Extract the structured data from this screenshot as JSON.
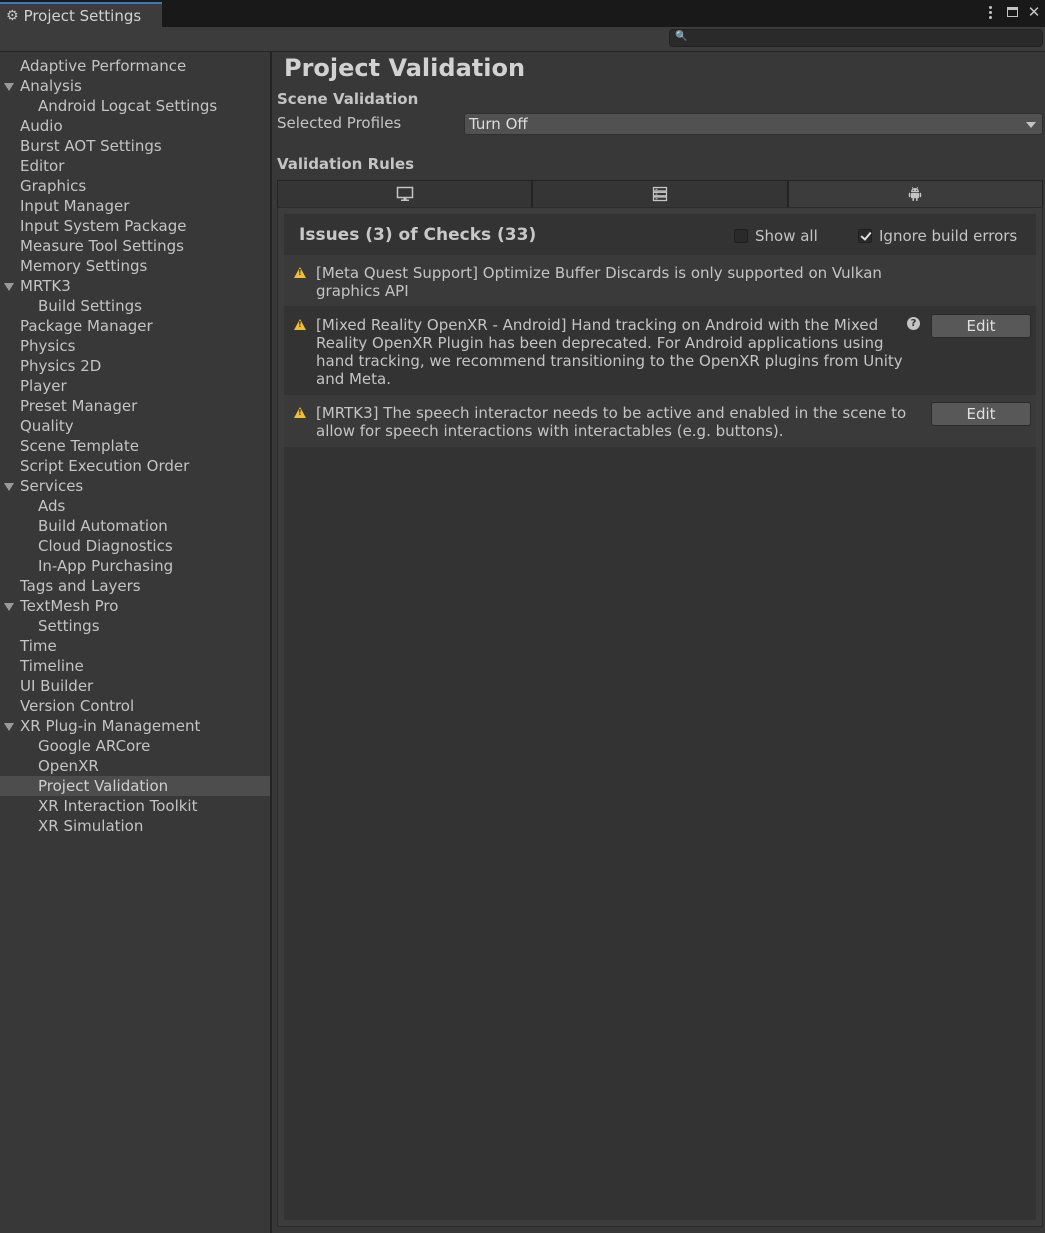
{
  "window": {
    "tab_title": "Project Settings",
    "icons": {
      "tab": "gear-icon",
      "more": "kebab-menu-icon",
      "maximize": "maximize-icon",
      "close": "close-icon"
    }
  },
  "search": {
    "placeholder": "",
    "value": ""
  },
  "sidebar": {
    "items": [
      {
        "label": "Adaptive Performance"
      },
      {
        "label": "Analysis"
      },
      {
        "label": "Android Logcat Settings"
      },
      {
        "label": "Audio"
      },
      {
        "label": "Burst AOT Settings"
      },
      {
        "label": "Editor"
      },
      {
        "label": "Graphics"
      },
      {
        "label": "Input Manager"
      },
      {
        "label": "Input System Package"
      },
      {
        "label": "Measure Tool Settings"
      },
      {
        "label": "Memory Settings"
      },
      {
        "label": "MRTK3"
      },
      {
        "label": "Build Settings"
      },
      {
        "label": "Package Manager"
      },
      {
        "label": "Physics"
      },
      {
        "label": "Physics 2D"
      },
      {
        "label": "Player"
      },
      {
        "label": "Preset Manager"
      },
      {
        "label": "Quality"
      },
      {
        "label": "Scene Template"
      },
      {
        "label": "Script Execution Order"
      },
      {
        "label": "Services"
      },
      {
        "label": "Ads"
      },
      {
        "label": "Build Automation"
      },
      {
        "label": "Cloud Diagnostics"
      },
      {
        "label": "In-App Purchasing"
      },
      {
        "label": "Tags and Layers"
      },
      {
        "label": "TextMesh Pro"
      },
      {
        "label": "Settings"
      },
      {
        "label": "Time"
      },
      {
        "label": "Timeline"
      },
      {
        "label": "UI Builder"
      },
      {
        "label": "Version Control"
      },
      {
        "label": "XR Plug-in Management"
      },
      {
        "label": "Google ARCore"
      },
      {
        "label": "OpenXR"
      },
      {
        "label": "Project Validation"
      },
      {
        "label": "XR Interaction Toolkit"
      },
      {
        "label": "XR Simulation"
      }
    ],
    "selected": "Project Validation"
  },
  "main": {
    "title": "Project Validation",
    "scene_validation": {
      "heading": "Scene Validation",
      "profiles_label": "Selected Profiles",
      "profiles_value": "Turn Off"
    },
    "validation_rules": {
      "heading": "Validation Rules",
      "platform_tabs": [
        {
          "icon": "standalone-monitor-icon",
          "active": false
        },
        {
          "icon": "server-icon",
          "active": false
        },
        {
          "icon": "android-icon",
          "active": true
        }
      ],
      "issues_header": "Issues (3) of Checks (33)",
      "show_all": {
        "label": "Show all",
        "checked": false
      },
      "ignore_build_errors": {
        "label": "Ignore build errors",
        "checked": true
      },
      "issues": [
        {
          "icon": "warning-icon",
          "lines": [
            "[Meta Quest Support] Optimize Buffer Discards is only supported on Vulkan",
            "graphics API"
          ]
        },
        {
          "icon": "warning-icon",
          "lines": [
            "[Mixed Reality OpenXR - Android] Hand tracking on Android with the Mixed",
            "Reality OpenXR Plugin has been deprecated. For Android applications using",
            "hand tracking, we recommend transitioning to the OpenXR plugins from Unity",
            "and Meta."
          ],
          "help_icon": "help-icon",
          "action_label": "Edit"
        },
        {
          "icon": "warning-icon",
          "lines": [
            "[MRTK3] The speech interactor needs to be active and enabled in the scene to",
            "allow for speech interactions with interactables (e.g. buttons)."
          ],
          "action_label": "Edit"
        }
      ]
    }
  }
}
